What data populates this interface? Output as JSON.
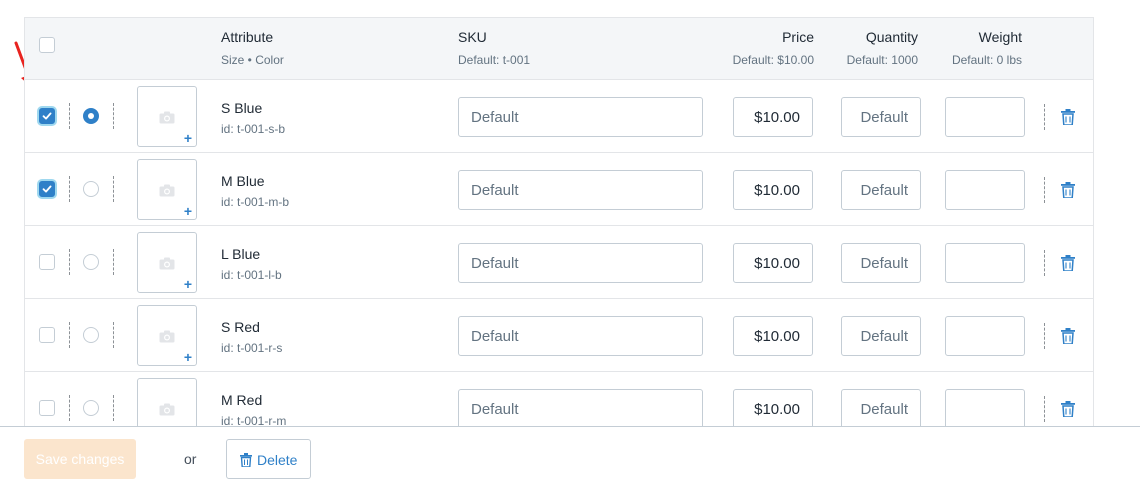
{
  "header": {
    "attribute_title": "Attribute",
    "attribute_sub": "Size • Color",
    "sku_title": "SKU",
    "sku_sub": "Default: t-001",
    "price_title": "Price",
    "price_sub": "Default: $10.00",
    "quantity_title": "Quantity",
    "quantity_sub": "Default: 1000",
    "weight_title": "Weight",
    "weight_sub": "Default: 0 lbs"
  },
  "variants": [
    {
      "name": "S Blue",
      "id": "id: t-001-s-b",
      "checked": true,
      "default": true,
      "sku_placeholder": "Default",
      "price": "$10.00",
      "quantity_placeholder": "Default",
      "weight": ""
    },
    {
      "name": "M Blue",
      "id": "id: t-001-m-b",
      "checked": true,
      "default": false,
      "sku_placeholder": "Default",
      "price": "$10.00",
      "quantity_placeholder": "Default",
      "weight": ""
    },
    {
      "name": "L Blue",
      "id": "id: t-001-l-b",
      "checked": false,
      "default": false,
      "sku_placeholder": "Default",
      "price": "$10.00",
      "quantity_placeholder": "Default",
      "weight": ""
    },
    {
      "name": "S Red",
      "id": "id: t-001-r-s",
      "checked": false,
      "default": false,
      "sku_placeholder": "Default",
      "price": "$10.00",
      "quantity_placeholder": "Default",
      "weight": ""
    },
    {
      "name": "M Red",
      "id": "id: t-001-r-m",
      "checked": false,
      "default": false,
      "sku_placeholder": "Default",
      "price": "$10.00",
      "quantity_placeholder": "Default",
      "weight": ""
    }
  ],
  "icons": {
    "image_upload": "camera-icon",
    "add": "plus-icon",
    "delete": "trash-icon",
    "annotation": "red-arrow-icon"
  },
  "footer": {
    "save_label": "Save changes",
    "or_label": "or",
    "delete_label": "Delete"
  },
  "colors": {
    "accent": "#2f80c8",
    "save_disabled": "#fbe5cd",
    "annotation_arrow": "#e8231f"
  }
}
